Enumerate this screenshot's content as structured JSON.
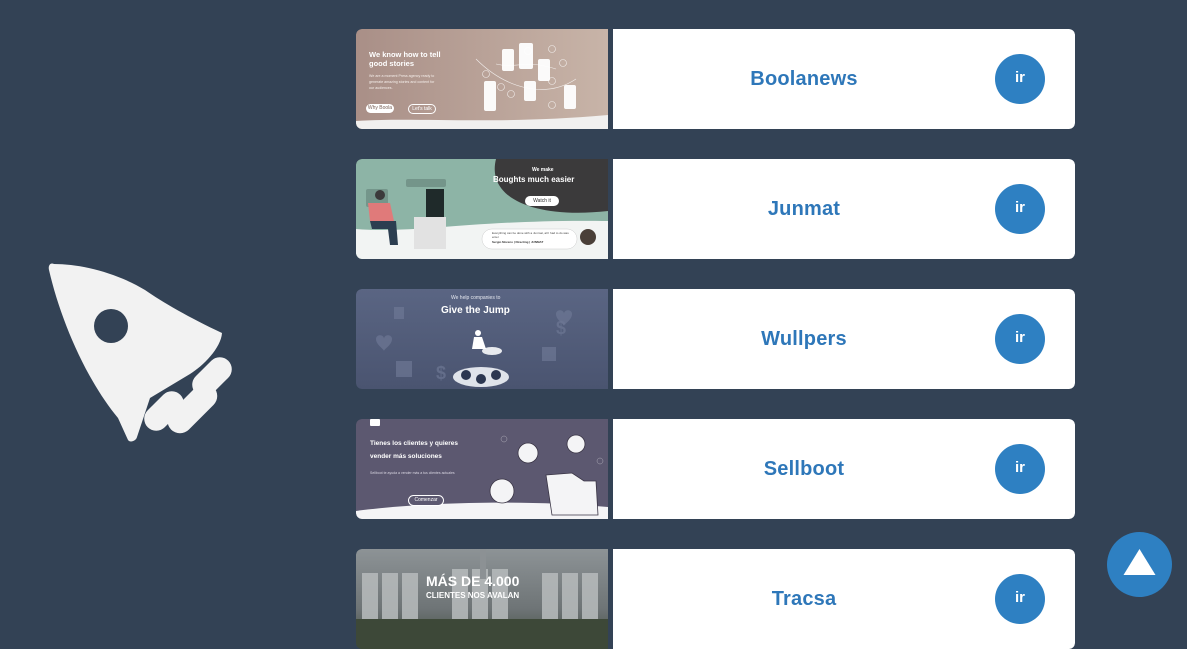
{
  "colors": {
    "background": "#334255",
    "accent": "#2e80c2",
    "title": "#2e77b9",
    "card": "#ffffff"
  },
  "hero_icon": "rocket-icon",
  "projects": [
    {
      "name": "Boolanews",
      "button": "ir",
      "thumb": {
        "headline": "We know how to tell good stories",
        "body": "We are a moment Press agency ready to generate amazing stories and content for our audiences.",
        "buttons": [
          "Why Boola",
          "Let's talk"
        ]
      }
    },
    {
      "name": "Junmat",
      "button": "ir",
      "thumb": {
        "kicker": "We make",
        "headline": "Boughts much easier",
        "button": "Watch it",
        "quote": "Everything can be done with a Junmat, all I had to do was enter",
        "quote_author": "Sergio Moreno | Directing | JUNMAT"
      }
    },
    {
      "name": "Wullpers",
      "button": "ir",
      "thumb": {
        "kicker": "We help companies to",
        "headline": "Give the Jump"
      }
    },
    {
      "name": "Sellboot",
      "button": "ir",
      "thumb": {
        "headline": "Tienes los clientes y quieres vender más soluciones",
        "body": "Sellboot te ayuda a vender más a tus clientes actuales",
        "button": "Comenzar"
      }
    },
    {
      "name": "Tracsa",
      "button": "ir",
      "thumb": {
        "headline": "MÁS DE 4.000",
        "subheadline": "CLIENTES NOS AVALAN"
      }
    }
  ],
  "scroll_top": {
    "icon": "arrow-up-icon"
  }
}
